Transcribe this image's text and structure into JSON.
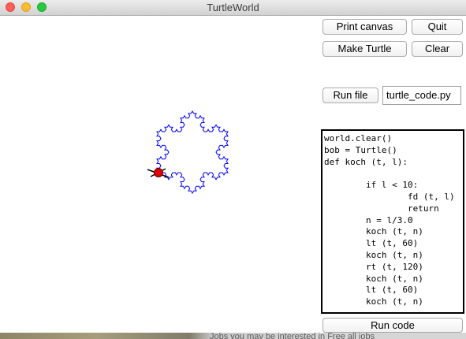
{
  "window": {
    "title": "TurtleWorld"
  },
  "buttons": {
    "print_canvas": "Print canvas",
    "quit": "Quit",
    "make_turtle": "Make Turtle",
    "clear": "Clear",
    "run_file": "Run file",
    "run_code": "Run code"
  },
  "file_field": {
    "value": "turtle_code.py"
  },
  "code": {
    "lines": [
      "world.clear()",
      "bob = Turtle()",
      "def koch (t, l):",
      "",
      "        if l < 10:",
      "                fd (t, l)",
      "                return",
      "        n = l/3.0",
      "        koch (t, n)",
      "        lt (t, 60)",
      "        koch (t, n)",
      "        rt (t, 120)",
      "        koch (t, n)",
      "        lt (t, 60)",
      "        koch (t, n)"
    ]
  },
  "background_text": "Jobs you may be interested in Free all jobs",
  "colors": {
    "snowflake_stroke": "#0000ff",
    "turtle_body": "#e00000",
    "turtle_legs": "#000000"
  },
  "icons": {
    "turtle": "turtle-icon"
  }
}
